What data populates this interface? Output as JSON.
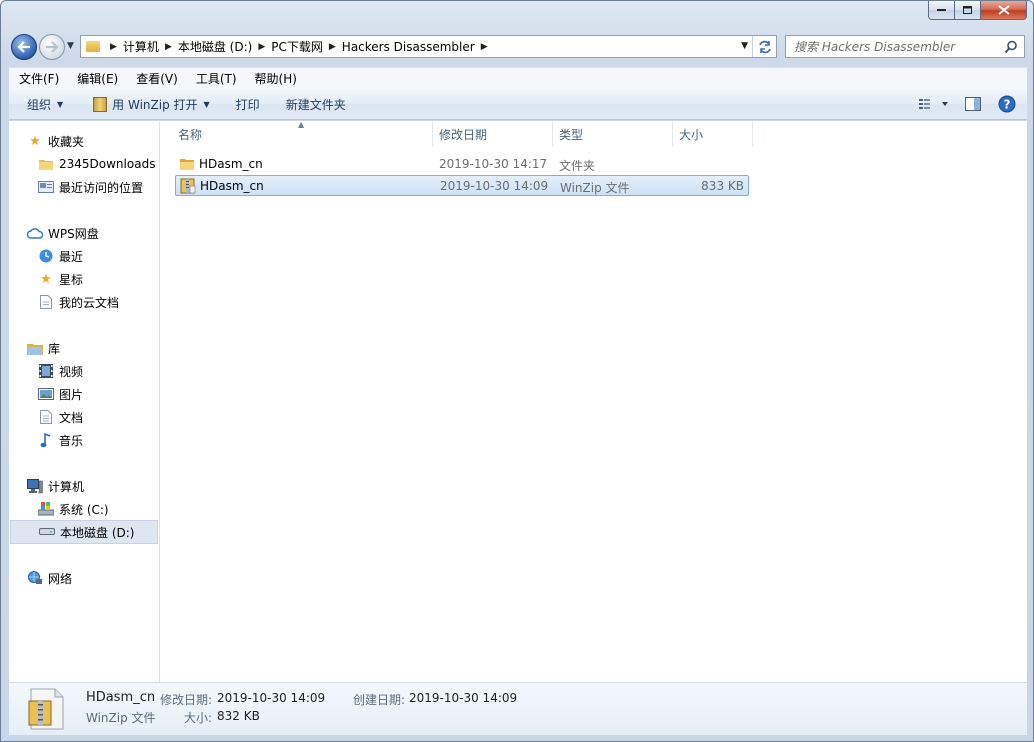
{
  "address": {
    "crumbs": [
      "计算机",
      "本地磁盘 (D:)",
      "PC下载网",
      "Hackers Disassembler"
    ]
  },
  "search": {
    "placeholder": "搜索 Hackers Disassembler"
  },
  "menu": [
    "文件(F)",
    "编辑(E)",
    "查看(V)",
    "工具(T)",
    "帮助(H)"
  ],
  "toolbar": {
    "organize": "组织",
    "open_with": "用 WinZip 打开",
    "print": "打印",
    "new_folder": "新建文件夹"
  },
  "sidebar": {
    "favorites": {
      "label": "收藏夹",
      "items": [
        "2345Downloads",
        "最近访问的位置"
      ]
    },
    "wps": {
      "label": "WPS网盘",
      "items": [
        "最近",
        "星标",
        "我的云文档"
      ]
    },
    "libraries": {
      "label": "库",
      "items": [
        "视频",
        "图片",
        "文档",
        "音乐"
      ]
    },
    "computer": {
      "label": "计算机",
      "items": [
        "系统 (C:)",
        "本地磁盘 (D:)"
      ]
    },
    "network": {
      "label": "网络"
    }
  },
  "columns": {
    "name": "名称",
    "date": "修改日期",
    "type": "类型",
    "size": "大小"
  },
  "files": [
    {
      "name": "HDasm_cn",
      "date": "2019-10-30 14:17",
      "type": "文件夹",
      "size": "",
      "icon": "folder-icon"
    },
    {
      "name": "HDasm_cn",
      "date": "2019-10-30 14:09",
      "type": "WinZip 文件",
      "size": "833 KB",
      "icon": "winzip-icon"
    }
  ],
  "details": {
    "name": "HDasm_cn",
    "type": "WinZip 文件",
    "modified_label": "修改日期:",
    "modified": "2019-10-30 14:09",
    "created_label": "创建日期:",
    "created": "2019-10-30 14:09",
    "size_label": "大小:",
    "size": "832 KB"
  },
  "colors": {
    "accent": "#3b6fb8",
    "selection": "#cde1f7",
    "folder": "#e9bd4f"
  }
}
